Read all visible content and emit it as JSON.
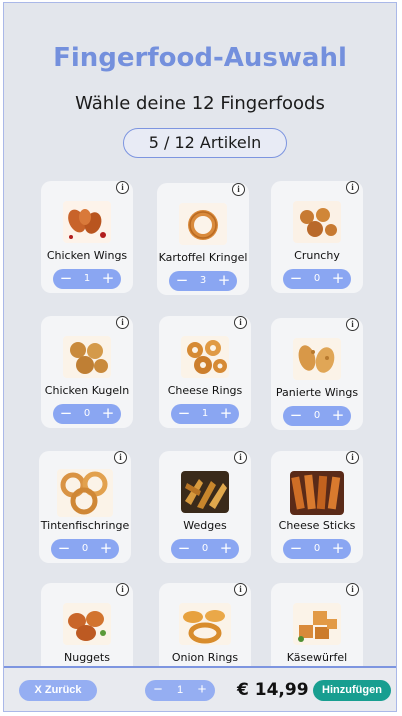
{
  "header": {
    "title": "Fingerfood-Auswahl",
    "subtitle": "Wähle deine 12 Fingerfoods",
    "counter": "5 / 12 Artikeln"
  },
  "items": [
    {
      "name": "Chicken Wings",
      "qty": "1",
      "icon": "chicken-wings-photo"
    },
    {
      "name": "Kartoffel Kringel",
      "qty": "3",
      "icon": "potato-ring-photo"
    },
    {
      "name": "Crunchy",
      "qty": "0",
      "icon": "crunchy-balls-photo"
    },
    {
      "name": "Chicken Kugeln",
      "qty": "0",
      "icon": "chicken-balls-photo"
    },
    {
      "name": "Cheese Rings",
      "qty": "1",
      "icon": "cheese-rings-photo"
    },
    {
      "name": "Panierte Wings",
      "qty": "0",
      "icon": "breaded-wings-photo"
    },
    {
      "name": "Tintenfischringe",
      "qty": "0",
      "icon": "squid-rings-photo"
    },
    {
      "name": "Wedges",
      "qty": "0",
      "icon": "wedges-photo"
    },
    {
      "name": "Cheese Sticks",
      "qty": "0",
      "icon": "cheese-sticks-photo"
    },
    {
      "name": "Nuggets",
      "qty": "",
      "icon": "nuggets-photo"
    },
    {
      "name": "Onion Rings",
      "qty": "",
      "icon": "onion-rings-photo"
    },
    {
      "name": "Käsewürfel",
      "qty": "",
      "icon": "cheese-cubes-photo"
    }
  ],
  "stepper": {
    "minus": "−",
    "plus": "+"
  },
  "info_icon": "i",
  "footer": {
    "back_label": "X Zurück",
    "qty": "1",
    "price": "€ 14,99",
    "add_label": "Hinzufügen"
  }
}
